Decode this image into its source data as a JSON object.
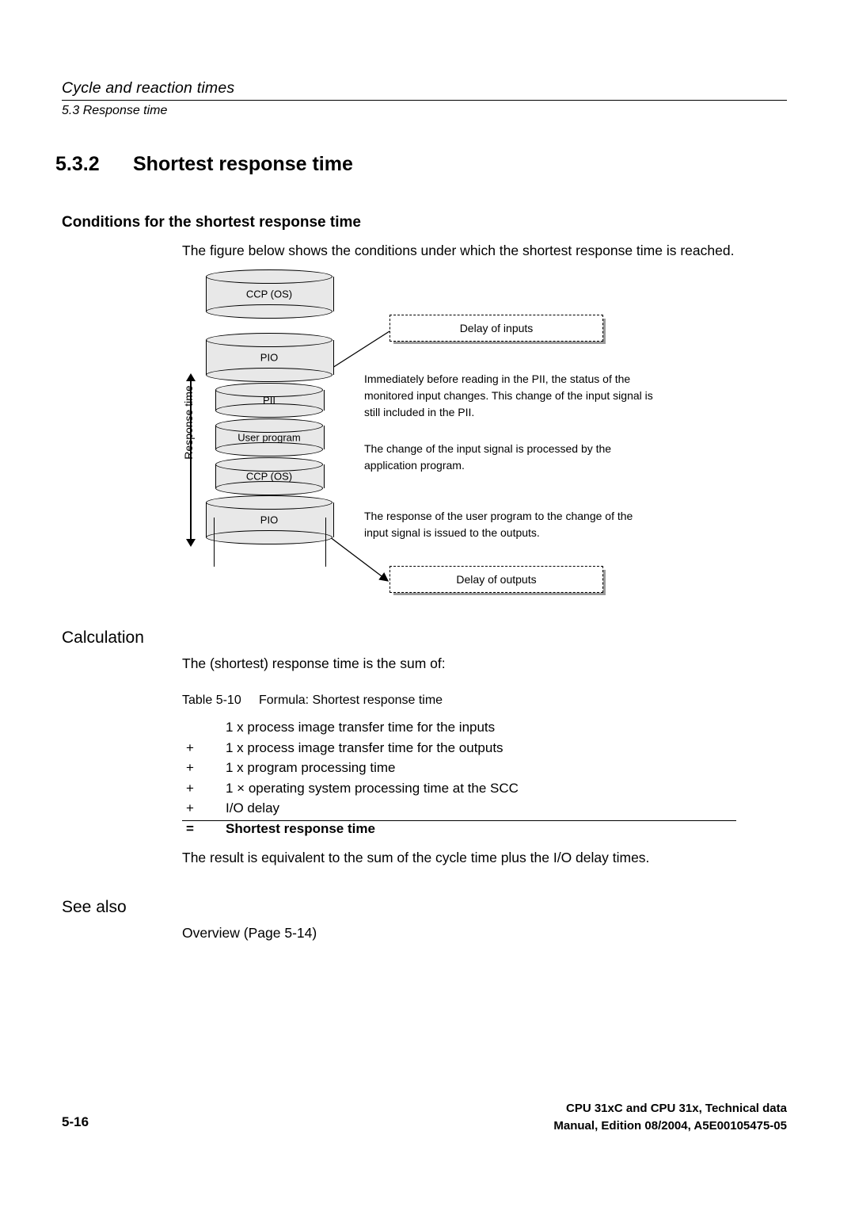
{
  "header": {
    "title": "Cycle and reaction times",
    "subtitle": "5.3 Response time"
  },
  "section": {
    "number": "5.3.2",
    "title": "Shortest response time"
  },
  "conditions": {
    "heading": "Conditions for the shortest response time",
    "intro": "The figure below shows the conditions under which the shortest response time is reached."
  },
  "figure": {
    "axis_label": "Response time",
    "cylinders": [
      {
        "label": "CCP (OS)"
      },
      {
        "label": "PIO"
      },
      {
        "label": "PII"
      },
      {
        "label": "User program"
      },
      {
        "label": "CCP (OS)"
      },
      {
        "label": "PIO"
      }
    ],
    "delay_inputs": "Delay of inputs",
    "delay_outputs": "Delay of outputs",
    "note1": "Immediately before reading in the PII, the status of the monitored input changes. This change of the input signal is still included in the PII.",
    "note2": "The change of the input signal is processed by the application program.",
    "note3": "The response of the user program to the change of the input signal is issued to the outputs."
  },
  "calculation": {
    "heading": "Calculation",
    "sum_of": "The (shortest) response time is the sum of:",
    "table_caption_label": "Table",
    "table_caption_number": "5-10",
    "table_caption_title": "Formula: Shortest response time",
    "rows": [
      {
        "sign": "",
        "text": "1 x process image transfer time for the inputs"
      },
      {
        "sign": "+",
        "text": "1 x process image transfer time for the outputs"
      },
      {
        "sign": "+",
        "text": "1 x program processing time"
      },
      {
        "sign": "+",
        "text": "1 × operating system processing time at the SCC"
      },
      {
        "sign": "+",
        "text": "I/O delay"
      },
      {
        "sign": "=",
        "text": "Shortest response time"
      }
    ],
    "result": "The result is equivalent to the sum of the cycle time plus the I/O delay times."
  },
  "see_also": {
    "heading": "See also",
    "link": "Overview (Page 5-14)"
  },
  "footer": {
    "page": "5-16",
    "line1": "CPU 31xC and CPU 31x, Technical data",
    "line2": "Manual, Edition 08/2004, A5E00105475-05"
  }
}
